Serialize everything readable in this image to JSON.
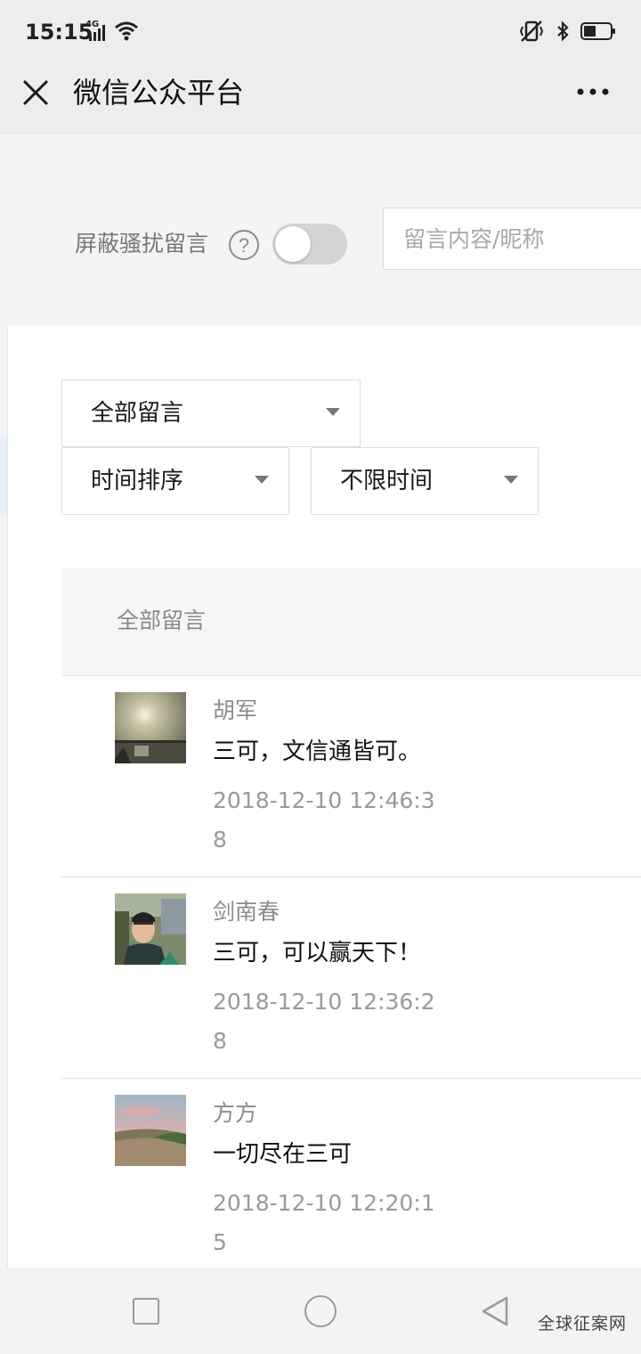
{
  "status_bar": {
    "time": "15:15",
    "network": "4G",
    "icons": [
      "signal-icon",
      "wifi-icon",
      "vibrate-icon",
      "bluetooth-icon",
      "battery-icon"
    ]
  },
  "navbar": {
    "title": "微信公众平台",
    "close_icon": "close-icon",
    "more_icon": "more-icon"
  },
  "filters": {
    "shield_label": "屏蔽骚扰留言",
    "shield_toggle_on": false,
    "search_placeholder": "留言内容/昵称",
    "type_dropdown": "全部留言",
    "sort_dropdown": "时间排序",
    "time_dropdown": "不限时间"
  },
  "list": {
    "header": "全部留言",
    "comments": [
      {
        "nickname": "胡军",
        "content": "三可，文信通皆可。",
        "time": "2018-12-10 12:46:38"
      },
      {
        "nickname": "剑南春",
        "content": "三可，可以赢天下！",
        "time": "2018-12-10 12:36:28"
      },
      {
        "nickname": "方方",
        "content": "一切尽在三可",
        "time": "2018-12-10 12:20:15"
      }
    ]
  },
  "bottom_nav": {
    "icons": [
      "recent-apps-icon",
      "home-icon",
      "back-icon"
    ],
    "watermark": "全球征案网"
  }
}
